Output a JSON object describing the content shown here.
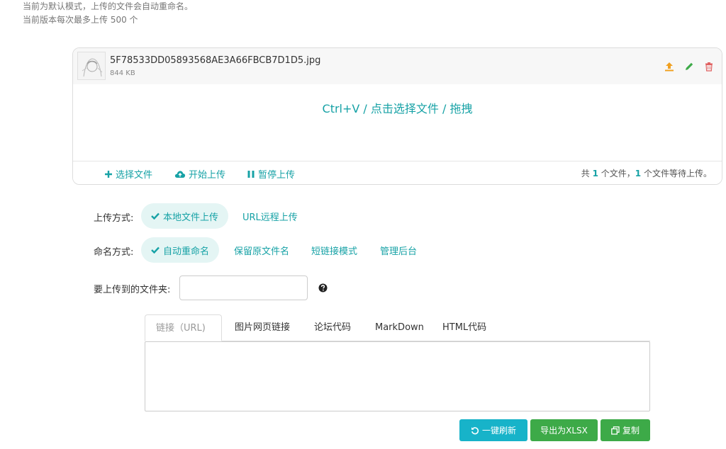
{
  "notice": {
    "line1": "当前为默认模式，上传的文件会自动重命名。",
    "line2": "当前版本每次最多上传 500 个"
  },
  "uploader": {
    "file": {
      "name": "5F78533DD05893568AE3A66FBCB7D1D5.jpg",
      "size": "844 KB",
      "actions": [
        "upload-icon",
        "edit-icon",
        "delete-icon"
      ]
    },
    "dropzone_text": "Ctrl+V / 点击选择文件 / 拖拽",
    "footer": {
      "choose_label": "选择文件",
      "start_label": "开始上传",
      "pause_label": "暂停上传",
      "status_prefix": "共",
      "total_count": "1",
      "status_mid": "个文件，",
      "waiting_count": "1",
      "status_suffix": "个文件等待上传。"
    }
  },
  "upload_mode": {
    "label": "上传方式:",
    "options": [
      "本地文件上传",
      "URL远程上传"
    ],
    "selected": "本地文件上传"
  },
  "naming_mode": {
    "label": "命名方式:",
    "options": [
      "自动重命名",
      "保留原文件名",
      "短链接模式",
      "管理后台"
    ],
    "selected": "自动重命名"
  },
  "folder": {
    "label": "要上传到的文件夹:",
    "value": "",
    "placeholder": ""
  },
  "output_tabs": {
    "tabs": [
      "链接（URL)",
      "图片网页链接",
      "论坛代码",
      "MarkDown",
      "HTML代码"
    ],
    "active": "链接（URL)"
  },
  "output_text": "",
  "buttons": {
    "refresh": "一键刷新",
    "export": "导出为XLSX",
    "copy": "复制"
  },
  "colors": {
    "accent": "#17a2a6",
    "info_button": "#17b3c9",
    "success_button": "#3daa48",
    "upload_icon": "#f0a020",
    "edit_icon": "#3daa48",
    "delete_icon": "#e06060"
  }
}
